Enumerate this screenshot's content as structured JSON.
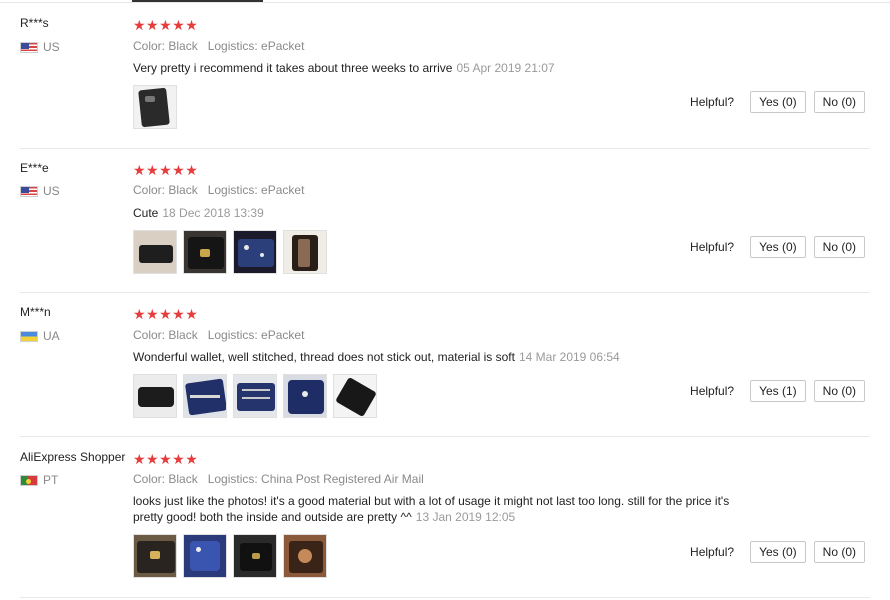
{
  "colors": {
    "star": "#e63c3c",
    "meta": "#8a8a8a",
    "date": "#9a9a9a"
  },
  "helpful_label": "Helpful?",
  "star_glyphs": "★★★★★",
  "reviews": [
    {
      "user": "R***s",
      "country": "US",
      "flag_icon": "us-flag-icon",
      "rating": 5,
      "color_label": "Color: Black",
      "logistics_label": "Logistics: ePacket",
      "text_lines": [
        "Very pretty i recommend it takes about three weeks to arrive"
      ],
      "date": "05 Apr 2019 21:07",
      "yes_label": "Yes (0)",
      "no_label": "No (0)",
      "photos": [
        "black-wallet-photo"
      ]
    },
    {
      "user": "E***e",
      "country": "US",
      "flag_icon": "us-flag-icon",
      "rating": 5,
      "color_label": "Color: Black",
      "logistics_label": "Logistics: ePacket",
      "text_lines": [
        "Cute"
      ],
      "date": "18 Dec 2018 13:39",
      "yes_label": "Yes (0)",
      "no_label": "No (0)",
      "photos": [
        "wallet-on-table-photo",
        "wallet-clasp-photo",
        "wallet-interior-photo",
        "wallet-in-hand-photo"
      ]
    },
    {
      "user": "M***n",
      "country": "UA",
      "flag_icon": "ua-flag-icon",
      "rating": 5,
      "color_label": "Color: Black",
      "logistics_label": "Logistics: ePacket",
      "text_lines": [
        "Wonderful wallet, well stitched, thread does not stick out, material is soft"
      ],
      "date": "14 Mar 2019 06:54",
      "yes_label": "Yes (1)",
      "no_label": "No (0)",
      "photos": [
        "wallet-closed-photo",
        "wallet-open-blue-photo",
        "wallet-card-slots-photo",
        "wallet-interior-blue-photo",
        "wallet-side-photo"
      ]
    },
    {
      "user": "AliExpress Shopper",
      "country": "PT",
      "flag_icon": "pt-flag-icon",
      "rating": 5,
      "color_label": "Color: Black",
      "logistics_label": "Logistics: China Post Registered Air Mail",
      "text_lines": [
        "looks just like the photos! it's a good material but with a lot of usage it might not last too long. still for the price it's",
        "pretty good! both the inside and outside are pretty ^^"
      ],
      "date": "13 Jan 2019 12:05",
      "yes_label": "Yes (0)",
      "no_label": "No (0)",
      "photos": [
        "wallet-gold-logo-photo",
        "wallet-blue-lining-photo",
        "wallet-dark-photo",
        "wallet-brown-photo"
      ]
    }
  ]
}
